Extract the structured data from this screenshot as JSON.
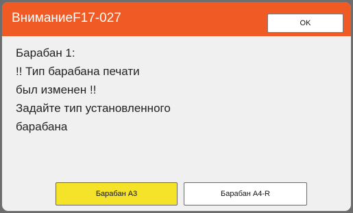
{
  "dialog": {
    "title": "ВниманиеF17-027",
    "ok_label": "OK",
    "message_lines": [
      "Барабан 1:",
      "!! Тип барабана печати",
      "был изменен !!",
      "Задайте тип установленного",
      "барабана"
    ],
    "buttons": [
      {
        "label": "Барабан A3",
        "selected": true
      },
      {
        "label": "Барабан A4-R",
        "selected": false
      }
    ]
  },
  "colors": {
    "title_bar": "#f05a24",
    "selected_button": "#f5e32a",
    "dialog_background": "#f0f0f0",
    "screen_background": "#6d6d6d"
  }
}
